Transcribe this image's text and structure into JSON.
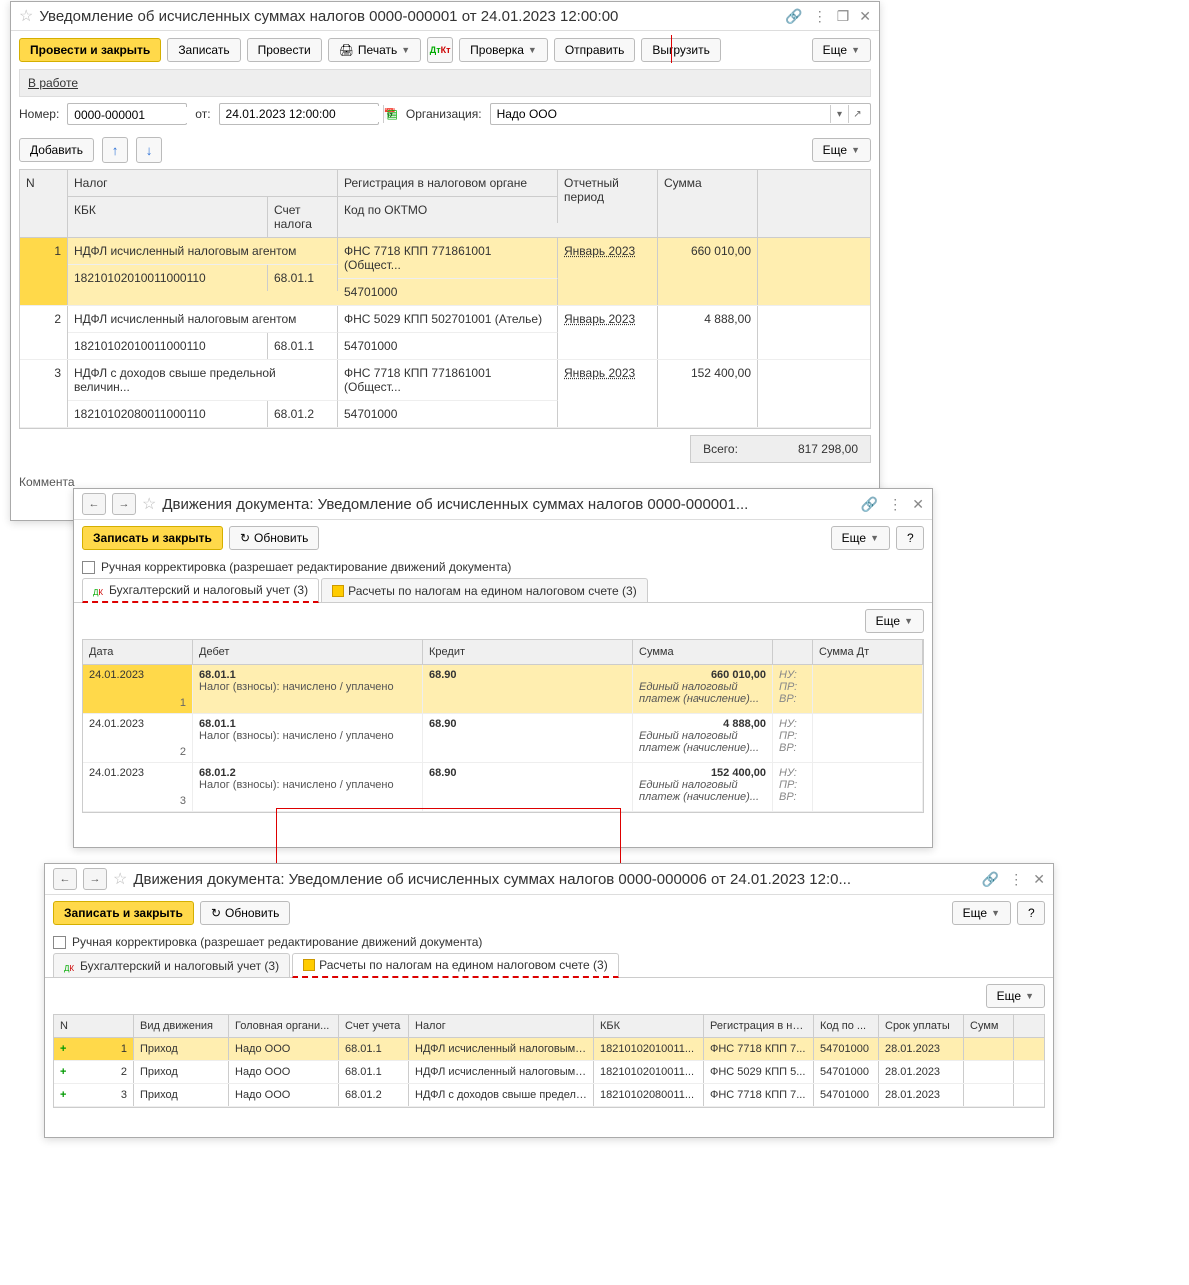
{
  "win1": {
    "title": "Уведомление об исчисленных суммах налогов 0000-000001 от 24.01.2023 12:00:00",
    "buttons": {
      "post_close": "Провести и закрыть",
      "write": "Записать",
      "post": "Провести",
      "print": "Печать",
      "check": "Проверка",
      "send": "Отправить",
      "export": "Выгрузить",
      "more": "Еще"
    },
    "status": "В работе",
    "labels": {
      "number": "Номер:",
      "from": "от:",
      "org": "Организация:",
      "add": "Добавить",
      "more": "Еще",
      "comment": "Коммента"
    },
    "fields": {
      "number": "0000-000001",
      "date": "24.01.2023 12:00:00",
      "org": "Надо ООО"
    },
    "grid": {
      "head": {
        "n": "N",
        "tax": "Налог",
        "kbk": "КБК",
        "acc": "Счет налога",
        "reg": "Регистрация в налоговом органе",
        "oktmo": "Код по ОКТМО",
        "period": "Отчетный период",
        "sum": "Сумма"
      },
      "rows": [
        {
          "n": "1",
          "tax": "НДФЛ исчисленный налоговым агентом",
          "kbk": "18210102010011000110",
          "acc": "68.01.1",
          "reg": "ФНС 7718 КПП 771861001 (Общест...",
          "oktmo": "54701000",
          "period": "Январь 2023",
          "sum": "660 010,00",
          "sel": true
        },
        {
          "n": "2",
          "tax": "НДФЛ исчисленный налоговым агентом",
          "kbk": "18210102010011000110",
          "acc": "68.01.1",
          "reg": "ФНС 5029 КПП 502701001 (Ателье)",
          "oktmo": "54701000",
          "period": "Январь 2023",
          "sum": "4 888,00"
        },
        {
          "n": "3",
          "tax": "НДФЛ с доходов свыше предельной величин...",
          "kbk": "18210102080011000110",
          "acc": "68.01.2",
          "reg": "ФНС 7718 КПП 771861001 (Общест...",
          "oktmo": "54701000",
          "period": "Январь 2023",
          "sum": "152 400,00"
        }
      ],
      "total_label": "Всего:",
      "total": "817 298,00"
    }
  },
  "win2": {
    "title": "Движения документа: Уведомление об исчисленных суммах налогов 0000-000001...",
    "buttons": {
      "save_close": "Записать и закрыть",
      "refresh": "Обновить",
      "more": "Еще",
      "help": "?"
    },
    "checkbox": "Ручная корректировка (разрешает редактирование движений документа)",
    "tabs": {
      "t1": "Бухгалтерский и налоговый учет (3)",
      "t2": "Расчеты по налогам на едином налоговом счете (3)"
    },
    "more": "Еще",
    "grid": {
      "head": {
        "date": "Дата",
        "deb": "Дебет",
        "cre": "Кредит",
        "sum": "Сумма",
        "sum_dt": "Сумма Дт"
      },
      "extra": {
        "nu": "НУ:",
        "pr": "ПР:",
        "vr": "ВР:"
      },
      "rows": [
        {
          "date": "24.01.2023",
          "idx": "1",
          "deb1": "68.01.1",
          "cre1": "68.90",
          "sum": "660 010,00",
          "deb2": "Налог (взносы): начислено / уплачено",
          "subsum": "Единый налоговый платеж (начисление)...",
          "sel": true
        },
        {
          "date": "24.01.2023",
          "idx": "2",
          "deb1": "68.01.1",
          "cre1": "68.90",
          "sum": "4 888,00",
          "deb2": "Налог (взносы): начислено / уплачено",
          "subsum": "Единый налоговый платеж (начисление)..."
        },
        {
          "date": "24.01.2023",
          "idx": "3",
          "deb1": "68.01.2",
          "cre1": "68.90",
          "sum": "152 400,00",
          "deb2": "Налог (взносы): начислено / уплачено",
          "subsum": "Единый налоговый платеж (начисление)..."
        }
      ]
    }
  },
  "win3": {
    "title": "Движения документа: Уведомление об исчисленных суммах налогов 0000-000006 от 24.01.2023 12:0...",
    "buttons": {
      "save_close": "Записать и закрыть",
      "refresh": "Обновить",
      "more": "Еще",
      "help": "?"
    },
    "checkbox": "Ручная корректировка (разрешает редактирование движений документа)",
    "tabs": {
      "t1": "Бухгалтерский и налоговый учет (3)",
      "t2": "Расчеты по налогам на едином налоговом счете (3)"
    },
    "more": "Еще",
    "grid": {
      "head": {
        "n": "N",
        "mv": "Вид движения",
        "org": "Головная органи...",
        "acc": "Счет учета",
        "tax": "Налог",
        "kbk": "КБК",
        "reg": "Регистрация в на...",
        "okt": "Код по ...",
        "due": "Срок уплаты",
        "sum": "Сумм"
      },
      "rows": [
        {
          "n": "1",
          "mv": "Приход",
          "org": "Надо ООО",
          "acc": "68.01.1",
          "tax": "НДФЛ исчисленный налоговым ...",
          "kbk": "18210102010011...",
          "reg": "ФНС 7718 КПП 7...",
          "okt": "54701000",
          "due": "28.01.2023",
          "sel": true
        },
        {
          "n": "2",
          "mv": "Приход",
          "org": "Надо ООО",
          "acc": "68.01.1",
          "tax": "НДФЛ исчисленный налоговым ...",
          "kbk": "18210102010011...",
          "reg": "ФНС 5029 КПП 5...",
          "okt": "54701000",
          "due": "28.01.2023"
        },
        {
          "n": "3",
          "mv": "Приход",
          "org": "Надо ООО",
          "acc": "68.01.2",
          "tax": "НДФЛ с доходов свыше предель...",
          "kbk": "18210102080011...",
          "reg": "ФНС 7718 КПП 7...",
          "okt": "54701000",
          "due": "28.01.2023"
        }
      ]
    }
  }
}
